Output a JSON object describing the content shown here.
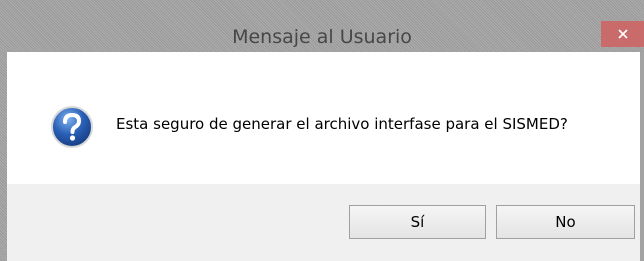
{
  "window": {
    "title": "Mensaje al Usuario",
    "close_symbol": "×"
  },
  "message": {
    "icon": "question-icon",
    "text": "Esta seguro de generar el archivo interfase para el SISMED?"
  },
  "buttons": {
    "yes_label": "Sí",
    "no_label": "No"
  },
  "colors": {
    "titlebar": "#a3a3a3",
    "close_button": "#c96b6b",
    "icon_blue": "#2a5fb5",
    "button_area": "#f0f0f0"
  }
}
